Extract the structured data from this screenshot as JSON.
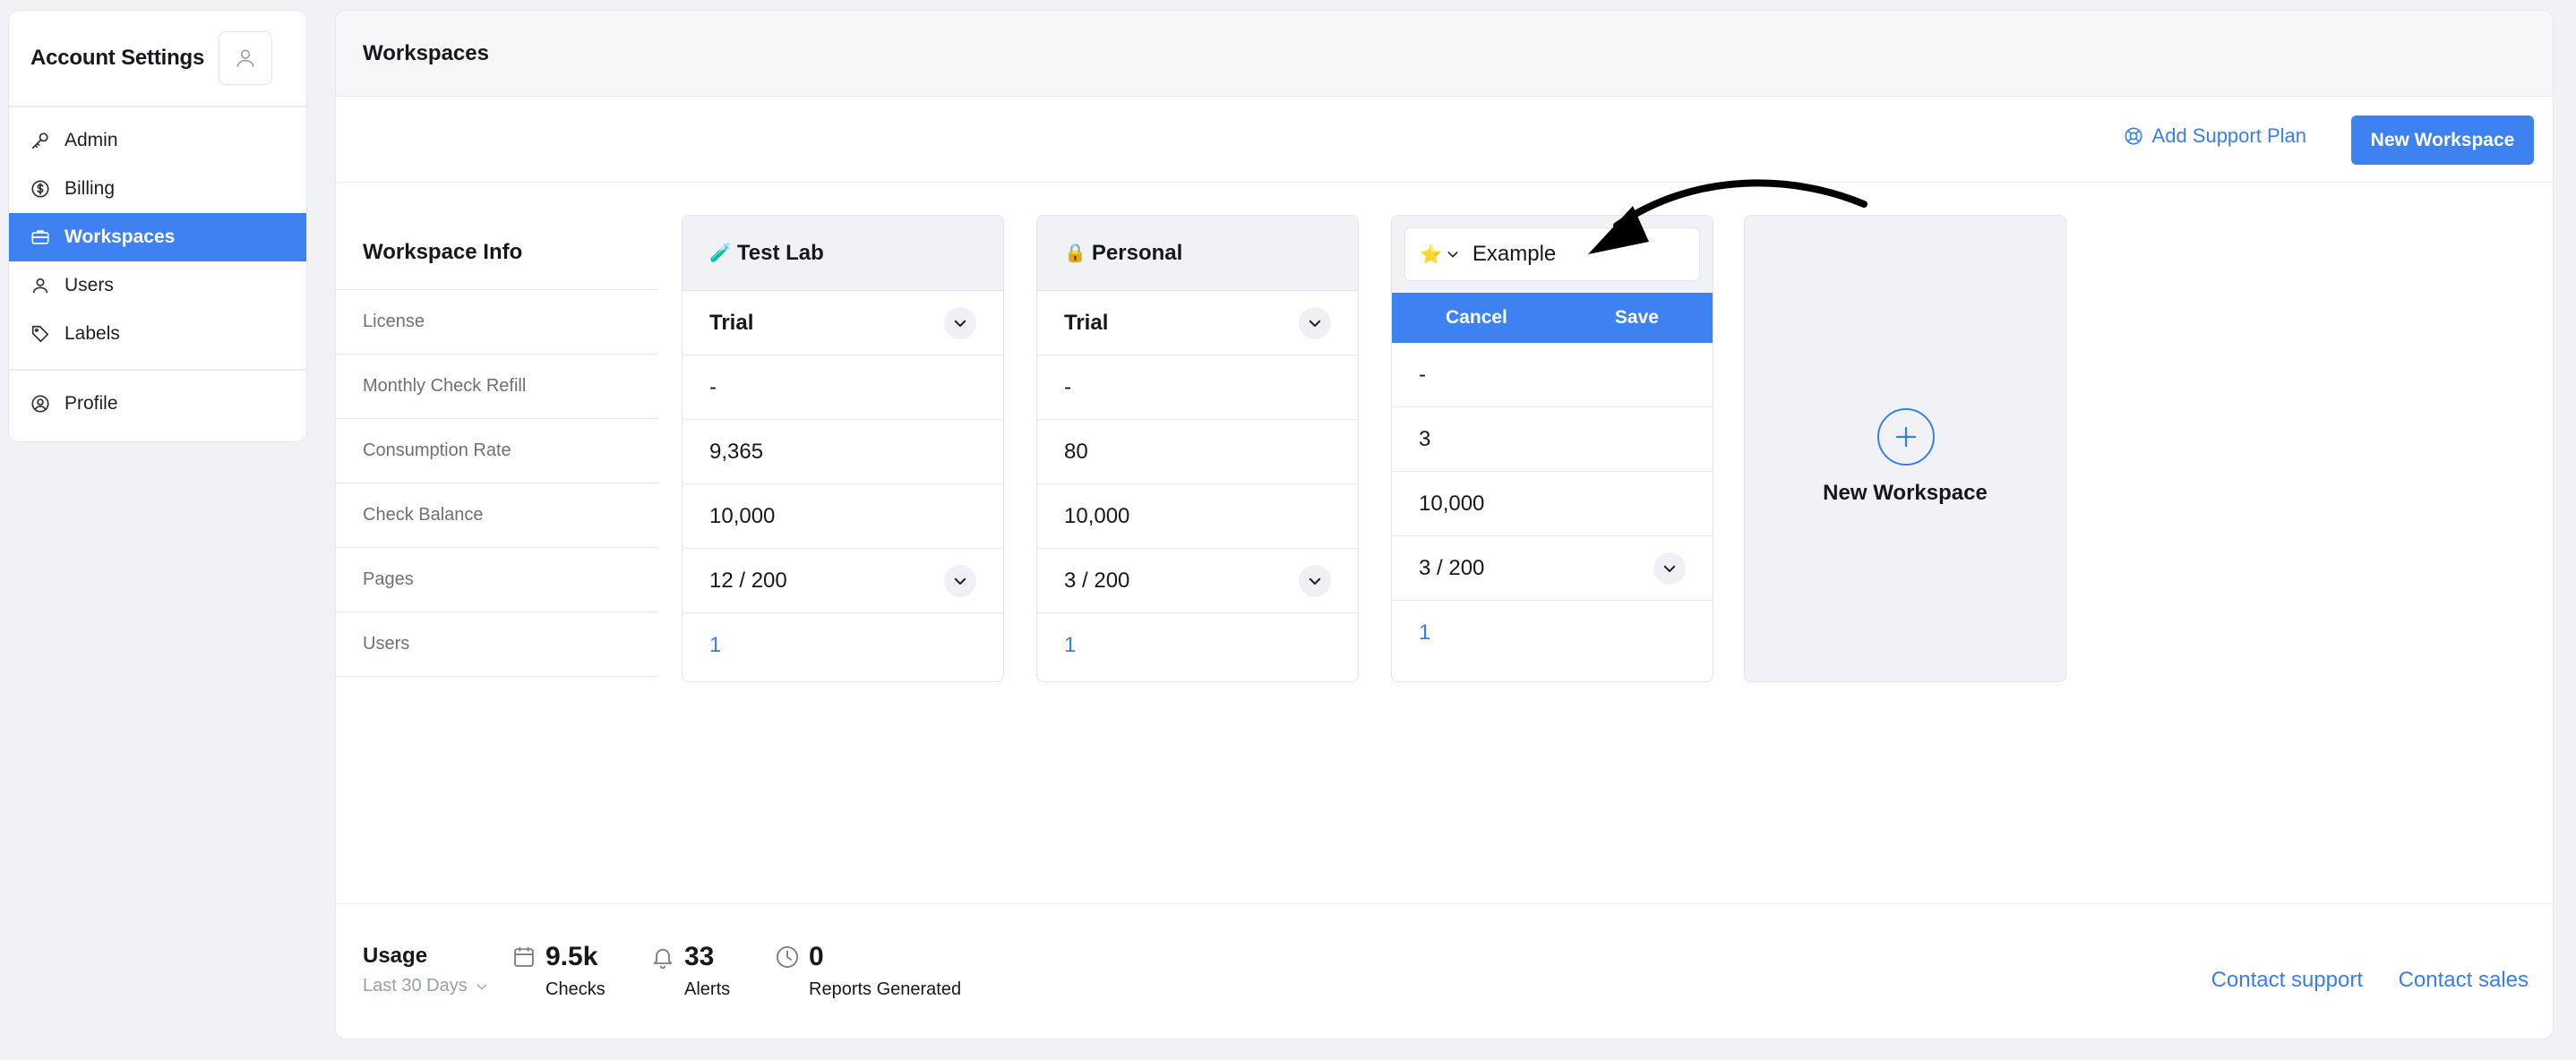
{
  "sidebar": {
    "title": "Account Settings",
    "avatar_icon": "user-icon",
    "items": [
      {
        "label": "Admin",
        "icon": "key-icon"
      },
      {
        "label": "Billing",
        "icon": "dollar-circle-icon"
      },
      {
        "label": "Workspaces",
        "icon": "briefcase-icon",
        "active": true
      },
      {
        "label": "Users",
        "icon": "user-icon"
      },
      {
        "label": "Labels",
        "icon": "tag-icon"
      }
    ],
    "profile": {
      "label": "Profile",
      "icon": "user-circle-icon"
    }
  },
  "main": {
    "title": "Workspaces",
    "toolbar": {
      "support_label": "Add Support Plan",
      "support_icon": "lifebuoy-icon",
      "new_workspace_label": "New Workspace"
    },
    "info": {
      "title": "Workspace Info",
      "rows": [
        "License",
        "Monthly Check Refill",
        "Consumption Rate",
        "Check Balance",
        "Pages",
        "Users"
      ]
    },
    "workspaces": [
      {
        "emoji": "🧪",
        "name": "Test Lab",
        "license": "Trial",
        "refill": "-",
        "consumption": "9,365",
        "balance": "10,000",
        "pages": "12 / 200",
        "users": "1"
      },
      {
        "emoji": "🔒",
        "name": "Personal",
        "license": "Trial",
        "refill": "-",
        "consumption": "80",
        "balance": "10,000",
        "pages": "3 / 200",
        "users": "1"
      }
    ],
    "editing": {
      "emoji": "⭐",
      "name_value": "Example",
      "cancel_label": "Cancel",
      "save_label": "Save",
      "refill": "-",
      "consumption": "3",
      "balance": "10,000",
      "pages": "3 / 200",
      "users": "1"
    },
    "new_card_label": "New Workspace"
  },
  "usage": {
    "title": "Usage",
    "range": "Last 30 Days",
    "stats": [
      {
        "icon": "calendar-icon",
        "value": "9.5k",
        "label": "Checks"
      },
      {
        "icon": "bell-icon",
        "value": "33",
        "label": "Alerts"
      },
      {
        "icon": "clock-icon",
        "value": "0",
        "label": "Reports Generated"
      }
    ],
    "contact_support": "Contact support",
    "contact_sales": "Contact sales"
  }
}
